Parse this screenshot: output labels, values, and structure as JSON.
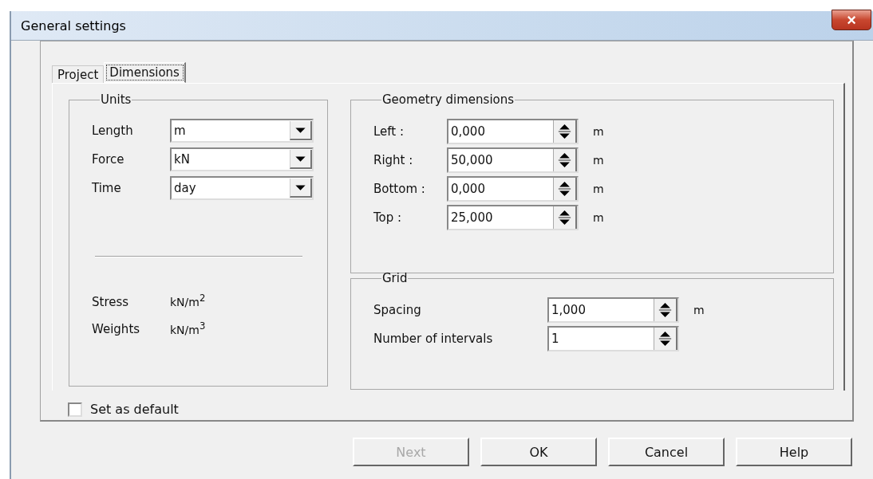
{
  "window": {
    "title": "General settings",
    "close": "×"
  },
  "tabs": [
    {
      "label": "Project",
      "selected": false
    },
    {
      "label": "Dimensions",
      "selected": true
    }
  ],
  "units": {
    "title": "Units",
    "fields": [
      {
        "label": "Length",
        "value": "m"
      },
      {
        "label": "Force",
        "value": "kN"
      },
      {
        "label": "Time",
        "value": "day"
      }
    ],
    "derived": [
      {
        "label": "Stress",
        "value": "kN/m$^{2}$"
      },
      {
        "label": "Weights",
        "value": "kN/m$^{3}$"
      }
    ]
  },
  "geometry": {
    "title": "Geometry dimensions",
    "fields": [
      {
        "label": "Left :",
        "value": "0,000",
        "unit": "m"
      },
      {
        "label": "Right :",
        "value": "50,000",
        "unit": "m"
      },
      {
        "label": "Bottom :",
        "value": "0,000",
        "unit": "m"
      },
      {
        "label": "Top :",
        "value": "25,000",
        "unit": "m"
      }
    ]
  },
  "grid": {
    "title": "Grid",
    "fields": [
      {
        "label": "Spacing",
        "value": "1,000",
        "unit": "m"
      },
      {
        "label": "Number of intervals",
        "value": "1"
      }
    ]
  },
  "set_default": {
    "label": "Set as default",
    "checked": false
  },
  "buttons": [
    {
      "label": "Next",
      "disabled": true
    },
    {
      "label": "OK",
      "disabled": false
    },
    {
      "label": "Cancel",
      "disabled": false
    },
    {
      "label": "Help",
      "disabled": false
    }
  ]
}
